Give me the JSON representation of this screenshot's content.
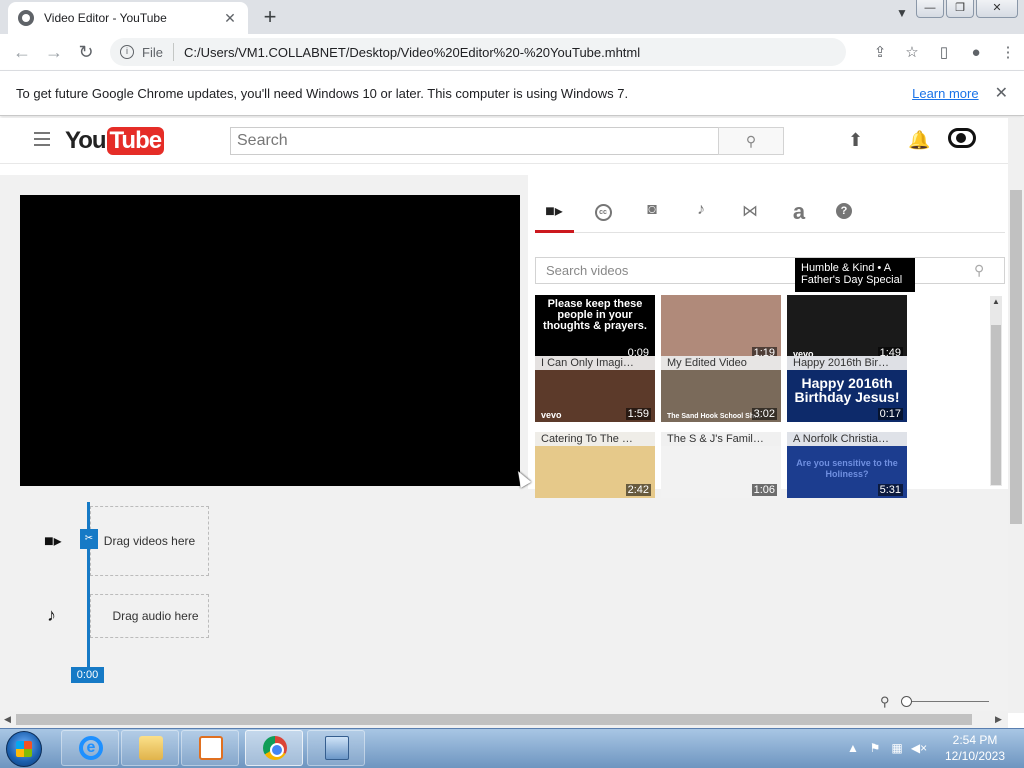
{
  "browser": {
    "tab_title": "Video Editor - YouTube",
    "tab_close": "✕",
    "new_tab": "+",
    "scheme_label": "File",
    "url": "C:/Users/VM1.COLLABNET/Desktop/Video%20Editor%20-%20YouTube.mhtml",
    "window_buttons": [
      "—",
      "❐",
      "✕"
    ]
  },
  "infobar": {
    "message": "To get future Google Chrome updates, you'll need Windows 10 or later. This computer is using Windows 7.",
    "link": "Learn more",
    "close": "✕"
  },
  "youtube": {
    "logo_you": "You",
    "logo_tube": "Tube",
    "search_placeholder": "Search"
  },
  "editor": {
    "tray_tabs": [
      "video-camera-icon",
      "cc-icon",
      "camera-icon",
      "music-note-icon",
      "transitions-icon",
      "text-icon",
      "help-icon"
    ],
    "cc_glyph": "cc",
    "text_glyph": "a",
    "help_glyph": "?",
    "search_videos_placeholder": "Search videos",
    "tooltip": "Humble & Kind • A Father's Day Special",
    "videos": [
      {
        "title": "",
        "text": "Please keep these people in your thoughts & prayers.",
        "duration": "0:09",
        "bg": "#000000"
      },
      {
        "title": "",
        "text": "",
        "duration": "1:19",
        "bg": "#b08a7a"
      },
      {
        "title": "",
        "text": "",
        "duration": "1:49",
        "bg": "#1a1a1a",
        "vevo": "vevo"
      },
      {
        "title": "I Can Only Imagi…",
        "text": "",
        "duration": "1:59",
        "bg": "#5c3a2a",
        "vevo": "vevo"
      },
      {
        "title": "My Edited Video",
        "text": "",
        "duration": "3:02",
        "bg": "#7a6a5a",
        "caption": "The Sand Hook School Sh…"
      },
      {
        "title": "Happy 2016th Bir…",
        "text": "Happy 2016th Birthday Jesus!",
        "duration": "0:17",
        "bg": "#0d2a6a"
      },
      {
        "title": "Catering To The …",
        "text": "",
        "duration": "2:42",
        "bg": "#e6c98a"
      },
      {
        "title": "The S & J's Famil…",
        "text": "",
        "duration": "1:06",
        "bg": "#f2f2f2"
      },
      {
        "title": "A Norfolk Christia…",
        "text": "",
        "duration": "5:31",
        "bg": "#1c3d8f",
        "caption": "Are you sensitive to the Holiness?"
      }
    ],
    "drop_video": "Drag videos here",
    "drop_audio": "Drag audio here",
    "playhead_time": "0:00"
  },
  "taskbar": {
    "time": "2:54 PM",
    "date": "12/10/2023",
    "ie_glyph": "e"
  }
}
